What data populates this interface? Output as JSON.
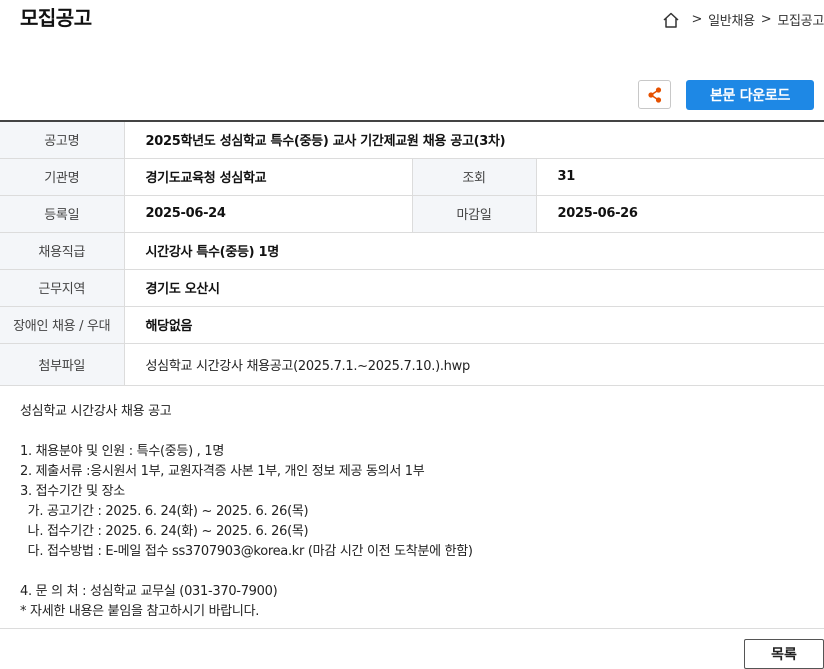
{
  "header": {
    "title": "모집공고",
    "breadcrumb": {
      "sep": ">",
      "items": [
        "일반채용",
        "모집공고"
      ]
    }
  },
  "actions": {
    "share_icon": "share-icon",
    "download_label": "본문 다운로드"
  },
  "info": {
    "notice_label": "공고명",
    "notice_value": "2025학년도 성심학교 특수(중등) 교사 기간제교원 채용 공고(3차)",
    "org_label": "기관명",
    "org_value": "경기도교육청 성심학교",
    "views_label": "조회",
    "views_value": "31",
    "reg_label": "등록일",
    "reg_value": "2025-06-24",
    "deadline_label": "마감일",
    "deadline_value": "2025-06-26",
    "position_label": "채용직급",
    "position_value": "시간강사 특수(중등) 1명",
    "region_label": "근무지역",
    "region_value": "경기도 오산시",
    "disability_label": "장애인 채용 / 우대",
    "disability_value": "해당없음",
    "attach_label": "첨부파일",
    "attach_value": "성심학교 시간강사 채용공고(2025.7.1.~2025.7.10.).hwp"
  },
  "content": {
    "lines": [
      "성심학교 시간강사 채용 공고",
      "",
      "1. 채용분야 및 인원 : 특수(중등) , 1명",
      "2. 제출서류 :응시원서 1부, 교원자격증 사본 1부, 개인 정보 제공 동의서 1부",
      "3. 접수기간 및 장소",
      "  가. 공고기간 : 2025. 6. 24(화) ~ 2025. 6. 26(목)",
      "  나. 접수기간 : 2025. 6. 24(화) ~ 2025. 6. 26(목)",
      "  다. 접수방법 : E-메일 접수 ss3707903@korea.kr (마감 시간 이전 도착분에 한함)",
      "",
      "4. 문 의 처 : 성심학교 교무실 (031-370-7900)",
      "* 자세한 내용은 붙임을 참고하시기 바랍니다."
    ]
  },
  "footer": {
    "list_label": "목록"
  },
  "colors": {
    "accent": "#1e88e5",
    "share": "#e65100"
  }
}
